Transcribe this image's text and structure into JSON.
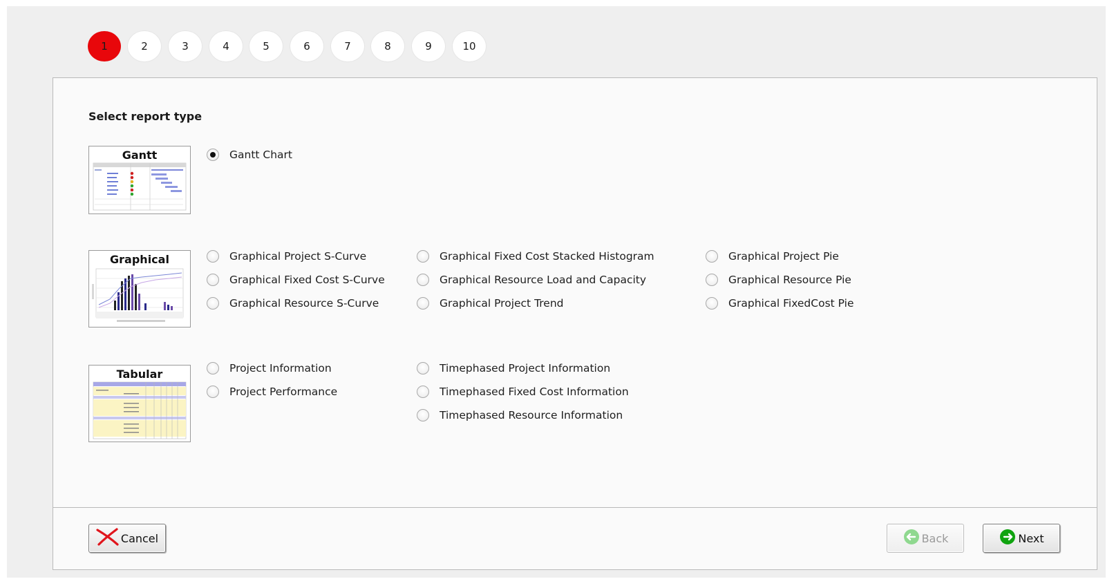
{
  "steps": [
    "1",
    "2",
    "3",
    "4",
    "5",
    "6",
    "7",
    "8",
    "9",
    "10"
  ],
  "active_step": "1",
  "heading": "Select report type",
  "groups": {
    "gantt": {
      "thumb_label": "Gantt",
      "options": [
        "Gantt Chart"
      ]
    },
    "graphical": {
      "thumb_label": "Graphical",
      "col1": [
        "Graphical Project S-Curve",
        "Graphical Fixed Cost S-Curve",
        "Graphical Resource S-Curve"
      ],
      "col2": [
        "Graphical Fixed Cost Stacked Histogram",
        "Graphical Resource Load and Capacity",
        "Graphical Project Trend"
      ],
      "col3": [
        "Graphical Project Pie",
        "Graphical Resource Pie",
        "Graphical FixedCost Pie"
      ]
    },
    "tabular": {
      "thumb_label": "Tabular",
      "col1": [
        "Project Information",
        "Project Performance"
      ],
      "col2": [
        "Timephased Project Information",
        "Timephased Fixed Cost Information",
        "Timephased Resource Information"
      ]
    }
  },
  "selected_option": "Gantt Chart",
  "buttons": {
    "cancel": "Cancel",
    "back": "Back",
    "next": "Next"
  },
  "colors": {
    "active_step": "#e8070b",
    "next_icon": "#0fa30f",
    "back_icon": "#8fd88f",
    "cancel_icon": "#e0151c"
  }
}
